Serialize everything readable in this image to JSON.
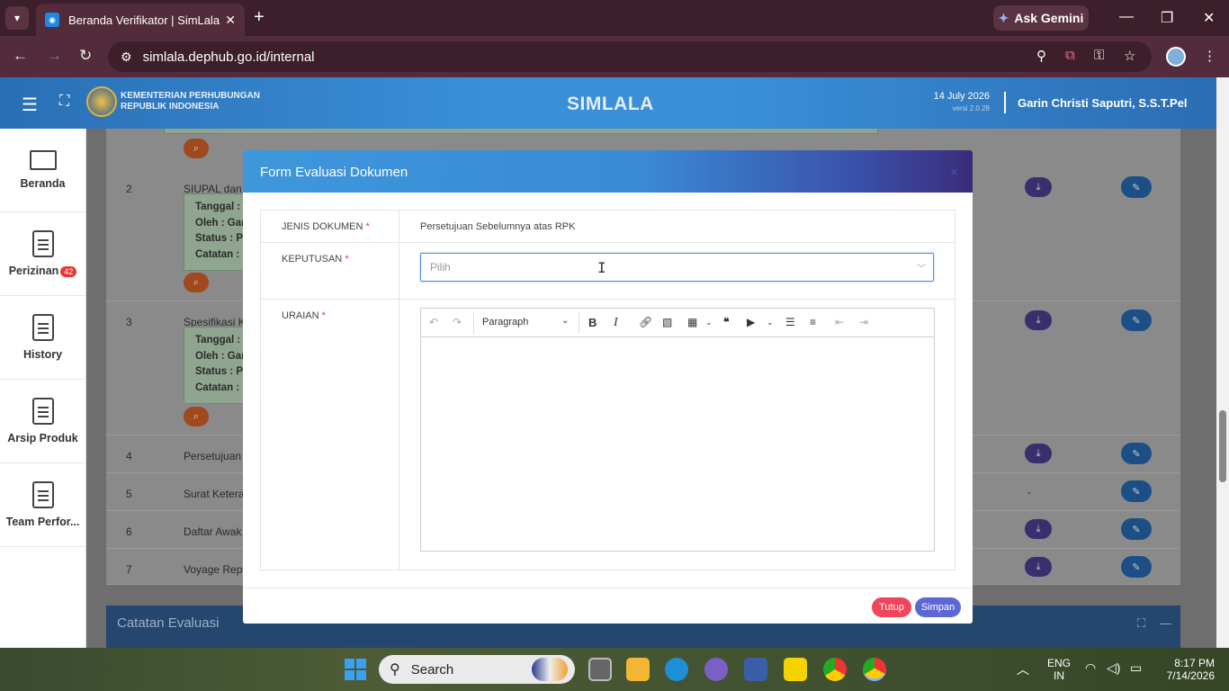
{
  "browser": {
    "tab_title": "Beranda Verifikator | SimLala",
    "url": "simlala.dephub.go.id/internal",
    "gemini_label": "Ask Gemini"
  },
  "app": {
    "org_line1": "KEMENTERIAN PERHUBUNGAN",
    "org_line2": "REPUBLIK INDONESIA",
    "title": "SIMLALA",
    "date": "14 July 2026",
    "version": "versi 2.0.28",
    "user_name": "Garin Christi Saputri, S.S.T.Pel"
  },
  "sidebar": {
    "items": [
      {
        "label": "Beranda",
        "icon": "monitor-icon"
      },
      {
        "label": "Perizinan",
        "icon": "document-icon",
        "badge": "42"
      },
      {
        "label": "History",
        "icon": "document-icon"
      },
      {
        "label": "Arsip Produk",
        "icon": "document-icon"
      },
      {
        "label": "Team Perfor...",
        "icon": "document-icon"
      }
    ]
  },
  "table": {
    "rows": [
      {
        "no": "2",
        "name": "SIUPAL dan B",
        "detail": [
          "Tanggal :",
          "Oleh : Gar",
          "Status : Pe",
          "Catatan : s"
        ],
        "edit_only": false
      },
      {
        "no": "3",
        "name": "Spesifikasi Ka",
        "detail": [
          "Tanggal :",
          "Oleh : Gar",
          "Status : Pe",
          "Catatan : s"
        ],
        "edit_only": false
      },
      {
        "no": "4",
        "name": "Persetujuan S",
        "edit_only": false
      },
      {
        "no": "5",
        "name": "Surat Keteran",
        "edit_only": true,
        "dash": "-"
      },
      {
        "no": "6",
        "name": "Daftar Awak K",
        "edit_only": false
      },
      {
        "no": "7",
        "name": "Voyage Repor",
        "edit_only": false
      }
    ]
  },
  "catatan_title": "Catatan Evaluasi",
  "modal": {
    "title": "Form Evaluasi Dokumen",
    "close": "×",
    "jenis_label": "JENIS DOKUMEN",
    "jenis_value": "Persetujuan Sebelumnya atas RPK",
    "keputusan_label": "KEPUTUSAN",
    "keputusan_placeholder": "Pilih",
    "uraian_label": "URAIAN",
    "editor_paragraph": "Paragraph",
    "required_mark": "*",
    "btn_tutup": "Tutup",
    "btn_simpan": "Simpan"
  },
  "taskbar": {
    "search_label": "Search",
    "lang1": "ENG",
    "lang2": "IN",
    "time": "8:17 PM",
    "date": "7/14/2026"
  }
}
